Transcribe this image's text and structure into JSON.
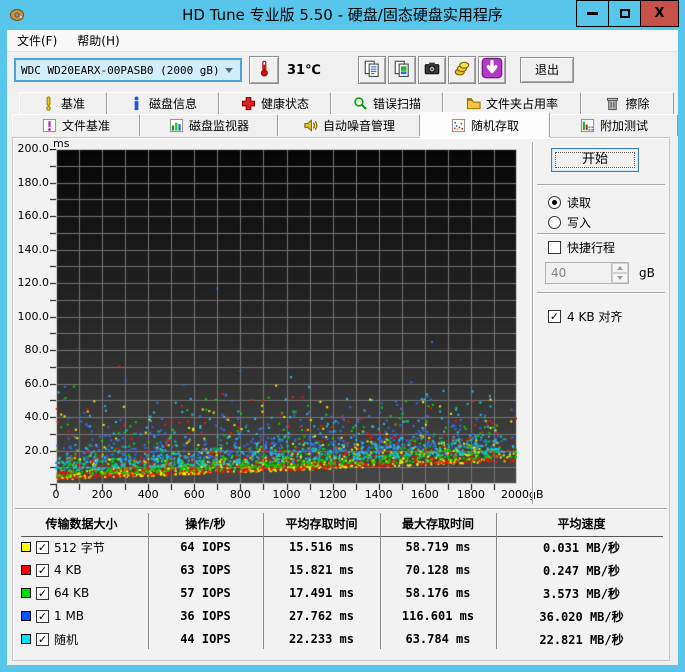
{
  "window": {
    "title": "HD Tune 专业版 5.50 - 硬盘/固态硬盘实用程序"
  },
  "menu": {
    "items": [
      "文件(F)",
      "帮助(H)"
    ]
  },
  "toolbar": {
    "drive_select": {
      "value": "WDC WD20EARX-00PASB0 (2000 gB)"
    },
    "temperature": "31℃",
    "buttons": [
      {
        "name": "copy-text-button",
        "icon": "copy-icon"
      },
      {
        "name": "copy-image-button",
        "icon": "copy-image-icon"
      },
      {
        "name": "screenshot-button",
        "icon": "camera-icon"
      },
      {
        "name": "save-button",
        "icon": "save-gold-icon"
      },
      {
        "name": "download-button",
        "icon": "download-icon"
      }
    ],
    "exit_label": "退出"
  },
  "tabs": {
    "row1": [
      {
        "label": "基准",
        "icon": "benchmark-icon",
        "width": 88
      },
      {
        "label": "磁盘信息",
        "icon": "info-icon",
        "width": 112
      },
      {
        "label": "健康状态",
        "icon": "health-icon",
        "width": 112
      },
      {
        "label": "错误扫描",
        "icon": "error-scan-icon",
        "width": 112
      },
      {
        "label": "文件夹占用率",
        "icon": "folder-icon",
        "width": 138
      },
      {
        "label": "擦除",
        "icon": "erase-icon",
        "width": 93
      }
    ],
    "row2": [
      {
        "label": "文件基准",
        "icon": "file-benchmark-icon",
        "width": 128
      },
      {
        "label": "磁盘监视器",
        "icon": "disk-monitor-icon",
        "width": 138
      },
      {
        "label": "自动噪音管理",
        "icon": "aam-icon",
        "width": 142
      },
      {
        "label": "随机存取",
        "icon": "random-access-icon",
        "width": 130,
        "active": true
      },
      {
        "label": "附加测试",
        "icon": "extra-tests-icon",
        "width": 128
      }
    ]
  },
  "controls": {
    "start_label": "开始",
    "read_label": "读取",
    "write_label": "写入",
    "read_selected": true,
    "short_stroke_label": "快捷行程",
    "short_stroke_checked": false,
    "short_stroke_value": "40",
    "short_stroke_unit": "gB",
    "align_label": "4 KB 对齐",
    "align_checked": true,
    "align_check_glyph": "✓"
  },
  "chart_data": {
    "type": "scatter",
    "x_label": "gB",
    "y_label": "ms",
    "x_range": [
      0,
      2000
    ],
    "y_range": [
      0,
      200
    ],
    "grid_x_step": 100,
    "grid_y_step": 10,
    "x_ticks": [
      "0",
      "200",
      "400",
      "600",
      "800",
      "1000",
      "1200",
      "1400",
      "1600",
      "1800",
      "2000gB"
    ],
    "x_tick_values": [
      0,
      200,
      400,
      600,
      800,
      1000,
      1200,
      1400,
      1600,
      1800,
      2000
    ],
    "y_ticks": [
      "20.0",
      "40.0",
      "60.0",
      "80.0",
      "100.0",
      "120.0",
      "140.0",
      "160.0",
      "180.0",
      "200.0"
    ],
    "y_tick_values": [
      20,
      40,
      60,
      80,
      100,
      120,
      140,
      160,
      180,
      200
    ],
    "background": {
      "top": "#060606",
      "bottom": "#464646",
      "grid": "#757575",
      "border": "#d9d9d9"
    },
    "min_envelope_ms": {
      "at_0": 2,
      "at_2000": 13
    },
    "seed": 20,
    "series": [
      {
        "name": "512 字节",
        "color": "#f5f500",
        "iops": 64,
        "avg_ms": 15.516,
        "max_ms": 58.719,
        "speed_mb_s": 0.031,
        "points": 640,
        "band_base": 0.5,
        "band_scale": 6.8,
        "cap_ms": 52,
        "max_x_gb": 955
      },
      {
        "name": "4 KB",
        "color": "#f51500",
        "iops": 63,
        "avg_ms": 15.821,
        "max_ms": 70.128,
        "speed_mb_s": 0.247,
        "points": 640,
        "band_base": 0.7,
        "band_scale": 7.0,
        "cap_ms": 56,
        "max_x_gb": 275
      },
      {
        "name": "64 KB",
        "color": "#00d400",
        "iops": 57,
        "avg_ms": 17.491,
        "max_ms": 58.176,
        "speed_mb_s": 3.573,
        "points": 600,
        "band_base": 2.5,
        "band_scale": 7.0,
        "cap_ms": 52,
        "max_x_gb": 78
      },
      {
        "name": "1 MB",
        "color": "#2f6df2",
        "iops": 36,
        "avg_ms": 27.762,
        "max_ms": 116.601,
        "speed_mb_s": 36.02,
        "points": 430,
        "band_base": 10,
        "band_scale": 8.5,
        "cap_ms": 62,
        "max_x_gb": 700
      },
      {
        "name": "随机",
        "color": "#17c3ee",
        "iops": 44,
        "avg_ms": 22.233,
        "max_ms": 63.784,
        "speed_mb_s": 22.821,
        "points": 520,
        "band_base": 5.5,
        "band_scale": 7.5,
        "cap_ms": 58,
        "max_x_gb": 1020
      }
    ]
  },
  "table": {
    "headers": [
      "传输数据大小",
      "操作/秒",
      "平均存取时间",
      "最大存取时间",
      "平均速度"
    ],
    "check_glyph": "✓",
    "rows": [
      {
        "swatch": "#ffff00",
        "checked": true,
        "label": "512 字节",
        "iops": "64 IOPS",
        "avg": "15.516 ms",
        "max": "58.719 ms",
        "speed": "0.031 MB/秒"
      },
      {
        "swatch": "#ff0000",
        "checked": true,
        "label": "4 KB",
        "iops": "63 IOPS",
        "avg": "15.821 ms",
        "max": "70.128 ms",
        "speed": "0.247 MB/秒"
      },
      {
        "swatch": "#00e000",
        "checked": true,
        "label": "64 KB",
        "iops": "57 IOPS",
        "avg": "17.491 ms",
        "max": "58.176 ms",
        "speed": "3.573 MB/秒"
      },
      {
        "swatch": "#0055ff",
        "checked": true,
        "label": "1 MB",
        "iops": "36 IOPS",
        "avg": "27.762 ms",
        "max": "116.601 ms",
        "speed": "36.020 MB/秒"
      },
      {
        "swatch": "#00e5ff",
        "checked": true,
        "label": "随机",
        "iops": "44 IOPS",
        "avg": "22.233 ms",
        "max": "63.784 ms",
        "speed": "22.821 MB/秒"
      }
    ]
  }
}
